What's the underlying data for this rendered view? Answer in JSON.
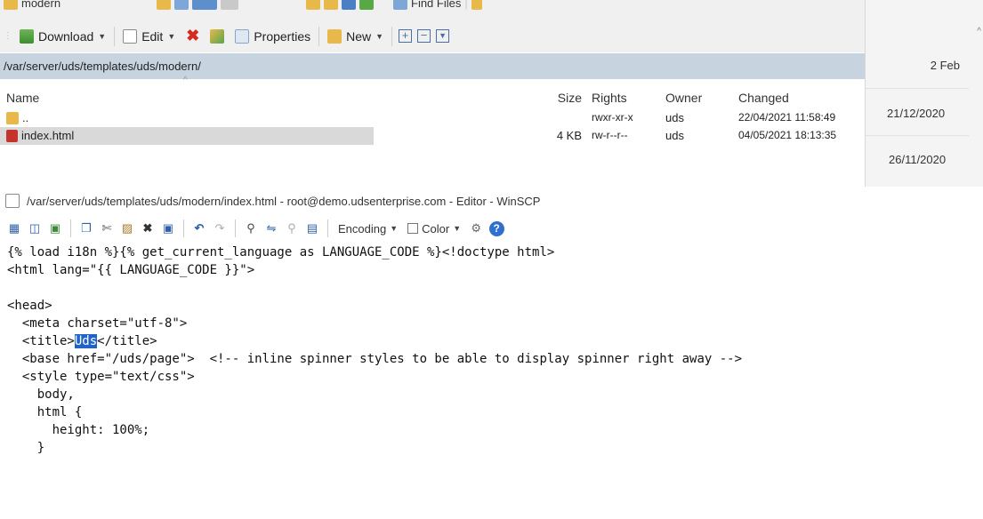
{
  "file_panel": {
    "partial_toolbar": {
      "location_label": "modern",
      "find_files_label": "Find Files"
    },
    "toolbar": {
      "download_label": "Download",
      "edit_label": "Edit",
      "properties_label": "Properties",
      "new_label": "New"
    },
    "path": "/var/server/uds/templates/uds/modern/",
    "columns": {
      "name": "Name",
      "size": "Size",
      "rights": "Rights",
      "owner": "Owner",
      "changed": "Changed"
    },
    "rows": [
      {
        "name": "..",
        "size": "",
        "rights": "rwxr-xr-x",
        "owner": "uds",
        "changed": "22/04/2021 11:58:49"
      },
      {
        "name": "index.html",
        "size": "4 KB",
        "rights": "rw-r--r--",
        "owner": "uds",
        "changed": "04/05/2021 18:13:35"
      }
    ]
  },
  "background_window": {
    "dates": [
      "2 Feb",
      "21/12/2020",
      "26/11/2020"
    ]
  },
  "editor": {
    "title": "/var/server/uds/templates/uds/modern/index.html - root@demo.udsenterprise.com - Editor - WinSCP",
    "toolbar": {
      "encoding_label": "Encoding",
      "color_label": "Color"
    },
    "code_lines": [
      {
        "before": "{% load i18n %}{% get_current_language as LANGUAGE_CODE %}<!doctype html>",
        "selected": "",
        "after": ""
      },
      {
        "before": "<html lang=\"{{ LANGUAGE_CODE }}\">",
        "selected": "",
        "after": ""
      },
      {
        "before": "",
        "selected": "",
        "after": ""
      },
      {
        "before": "<head>",
        "selected": "",
        "after": ""
      },
      {
        "before": "  <meta charset=\"utf-8\">",
        "selected": "",
        "after": ""
      },
      {
        "before": "  <title>",
        "selected": "Uds",
        "after": "</title>"
      },
      {
        "before": "  <base href=\"/uds/page\">  <!-- inline spinner styles to be able to display spinner right away -->",
        "selected": "",
        "after": ""
      },
      {
        "before": "  <style type=\"text/css\">",
        "selected": "",
        "after": ""
      },
      {
        "before": "    body,",
        "selected": "",
        "after": ""
      },
      {
        "before": "    html {",
        "selected": "",
        "after": ""
      },
      {
        "before": "      height: 100%;",
        "selected": "",
        "after": ""
      },
      {
        "before": "    }",
        "selected": "",
        "after": ""
      }
    ]
  }
}
